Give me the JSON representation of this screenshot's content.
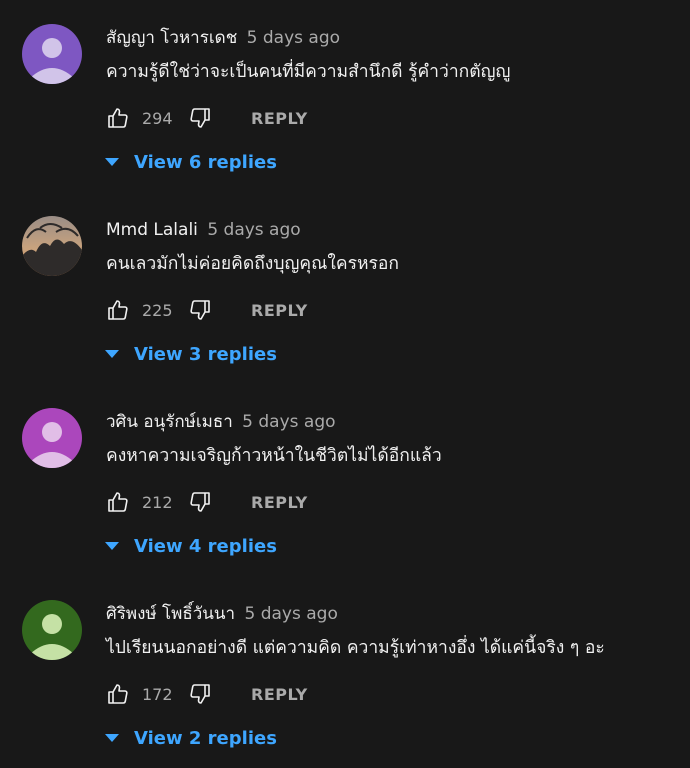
{
  "comments": [
    {
      "author": "สัญญา โวหารเดช",
      "time": "5 days ago",
      "text": "ความรู้ดีใช่ว่าจะเป็นคนที่มีความสำนึกดี รู้คำว่ากตัญญู",
      "likes": "294",
      "reply_label": "REPLY",
      "view_replies": "View 6 replies",
      "avatar_color": "#7e57c2",
      "avatar_figure_color": "#d1c4e9"
    },
    {
      "author": "Mmd Lalali",
      "time": "5 days ago",
      "text": "คนเลวมักไม่ค่อยคิดถึงบุญคุณใครหรอก",
      "likes": "225",
      "reply_label": "REPLY",
      "view_replies": "View 3 replies",
      "avatar_color": "#7d6a60",
      "avatar_figure_color": "#2e2b2a"
    },
    {
      "author": "วศิน อนุรักษ์เมธา",
      "time": "5 days ago",
      "text": "คงหาความเจริญก้าวหน้าในชีวิตไม่ได้อีกแล้ว",
      "likes": "212",
      "reply_label": "REPLY",
      "view_replies": "View 4 replies",
      "avatar_color": "#ab47bc",
      "avatar_figure_color": "#e1bee7"
    },
    {
      "author": "ศิริพงษ์ โพธิ์วันนา",
      "time": "5 days ago",
      "text": "ไปเรียนนอกอย่างดี แต่ความคิด ความรู้เท่าหางอึ่ง ได้แค่นี้จริง ๆ อะ",
      "likes": "172",
      "reply_label": "REPLY",
      "view_replies": "View 2 replies",
      "avatar_color": "#33691e",
      "avatar_figure_color": "#c5e1a5"
    }
  ],
  "icons": {
    "like": "thumbs-up-icon",
    "dislike": "thumbs-down-icon",
    "expand": "caret-down-icon"
  },
  "colors": {
    "background": "#181818",
    "link": "#3ea6ff",
    "secondary_text": "#aaaaaa"
  }
}
